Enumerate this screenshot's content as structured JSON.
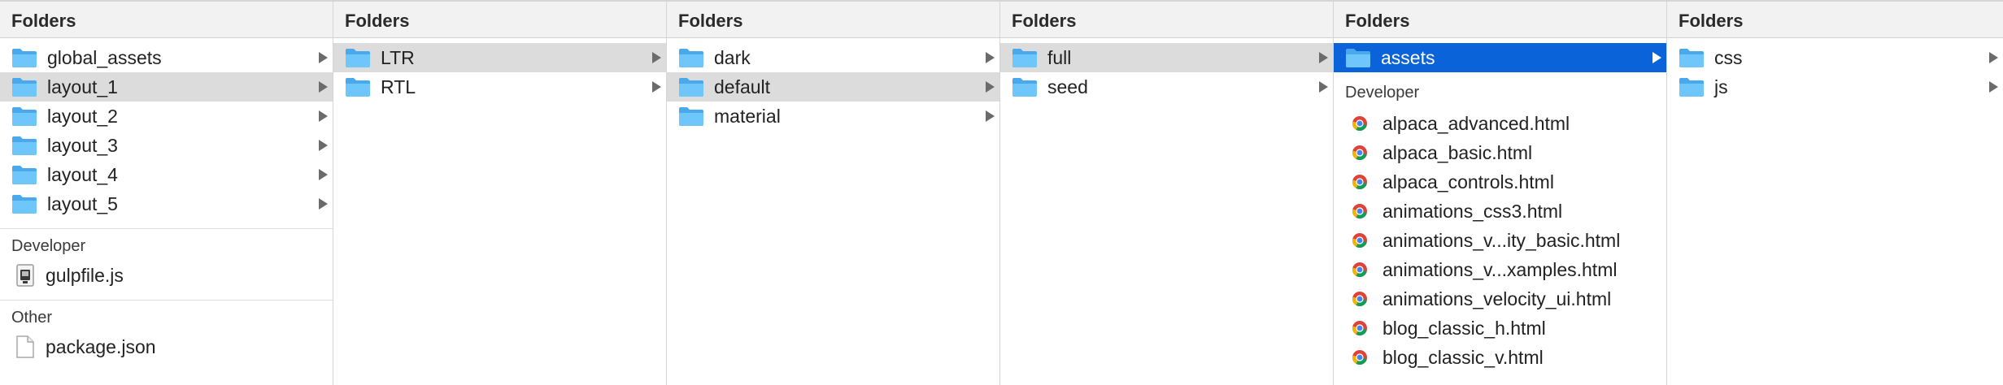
{
  "columns": [
    {
      "header": "Folders",
      "folders": [
        {
          "name": "global_assets",
          "selected": false
        },
        {
          "name": "layout_1",
          "selected": true
        },
        {
          "name": "layout_2",
          "selected": false
        },
        {
          "name": "layout_3",
          "selected": false
        },
        {
          "name": "layout_4",
          "selected": false
        },
        {
          "name": "layout_5",
          "selected": false
        }
      ],
      "sections": [
        {
          "title": "Developer",
          "files": [
            {
              "name": "gulpfile.js",
              "icon": "js-file-icon"
            }
          ]
        },
        {
          "title": "Other",
          "files": [
            {
              "name": "package.json",
              "icon": "document-icon"
            }
          ]
        }
      ]
    },
    {
      "header": "Folders",
      "folders": [
        {
          "name": "LTR",
          "selected": true
        },
        {
          "name": "RTL",
          "selected": false
        }
      ]
    },
    {
      "header": "Folders",
      "folders": [
        {
          "name": "dark",
          "selected": false
        },
        {
          "name": "default",
          "selected": true
        },
        {
          "name": "material",
          "selected": false
        }
      ]
    },
    {
      "header": "Folders",
      "folders": [
        {
          "name": "full",
          "selected": true
        },
        {
          "name": "seed",
          "selected": false
        }
      ]
    },
    {
      "header": "Folders",
      "folders": [
        {
          "name": "assets",
          "selected": true,
          "active": true
        }
      ],
      "sections": [
        {
          "title": "Developer",
          "files": [
            {
              "name": "alpaca_advanced.html",
              "icon": "chrome-html-icon"
            },
            {
              "name": "alpaca_basic.html",
              "icon": "chrome-html-icon"
            },
            {
              "name": "alpaca_controls.html",
              "icon": "chrome-html-icon"
            },
            {
              "name": "animations_css3.html",
              "icon": "chrome-html-icon"
            },
            {
              "name": "animations_v...ity_basic.html",
              "icon": "chrome-html-icon"
            },
            {
              "name": "animations_v...xamples.html",
              "icon": "chrome-html-icon"
            },
            {
              "name": "animations_velocity_ui.html",
              "icon": "chrome-html-icon"
            },
            {
              "name": "blog_classic_h.html",
              "icon": "chrome-html-icon"
            },
            {
              "name": "blog_classic_v.html",
              "icon": "chrome-html-icon"
            }
          ]
        }
      ]
    },
    {
      "header": "Folders",
      "folders": [
        {
          "name": "css",
          "selected": false
        },
        {
          "name": "js",
          "selected": false
        }
      ]
    }
  ],
  "colors": {
    "folder": "#5bb8f5",
    "selection_gray": "#dcdcdc",
    "selection_blue": "#0a63d8"
  }
}
